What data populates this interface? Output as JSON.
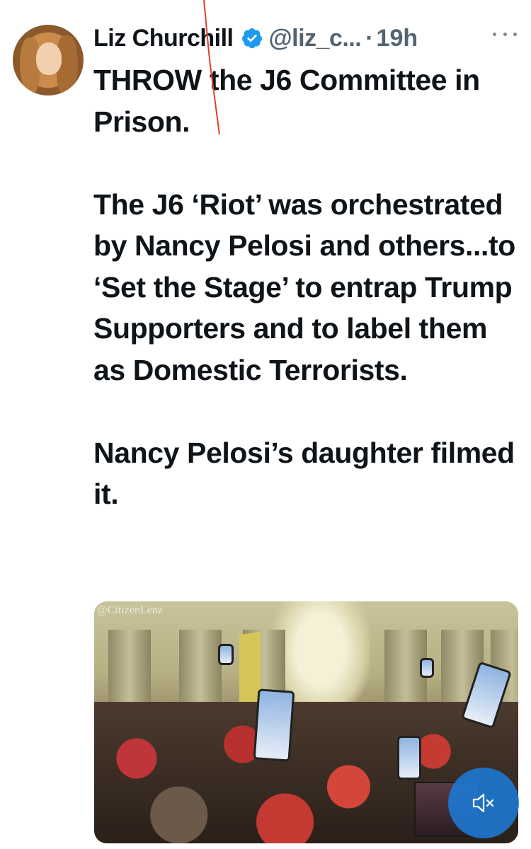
{
  "tweet": {
    "author": {
      "display_name": "Liz Churchill",
      "handle": "@liz_c...",
      "separator": "·",
      "time": "19h",
      "verified": true
    },
    "body": [
      "THROW the J6 Committee in Prison.",
      "The J6 ‘Riot’ was orchestrated by Nancy Pelosi and others...to ‘Set the Stage’ to entrap Trump Supporters and to label them as Domestic Terrorists.",
      "Nancy Pelosi’s daughter filmed it."
    ],
    "media": {
      "watermark": "@CitizenLenz",
      "type": "video",
      "muted": true
    },
    "colors": {
      "verified_badge": "#1d9bf0",
      "text": "#0f1419",
      "secondary_text": "#536471",
      "overlay_button": "#1d7ad7",
      "annotation_line": "#e0402a"
    },
    "icons": {
      "verified": "verified-badge-icon",
      "more": "more-horizontal-icon",
      "mute": "speaker-muted-icon"
    }
  }
}
